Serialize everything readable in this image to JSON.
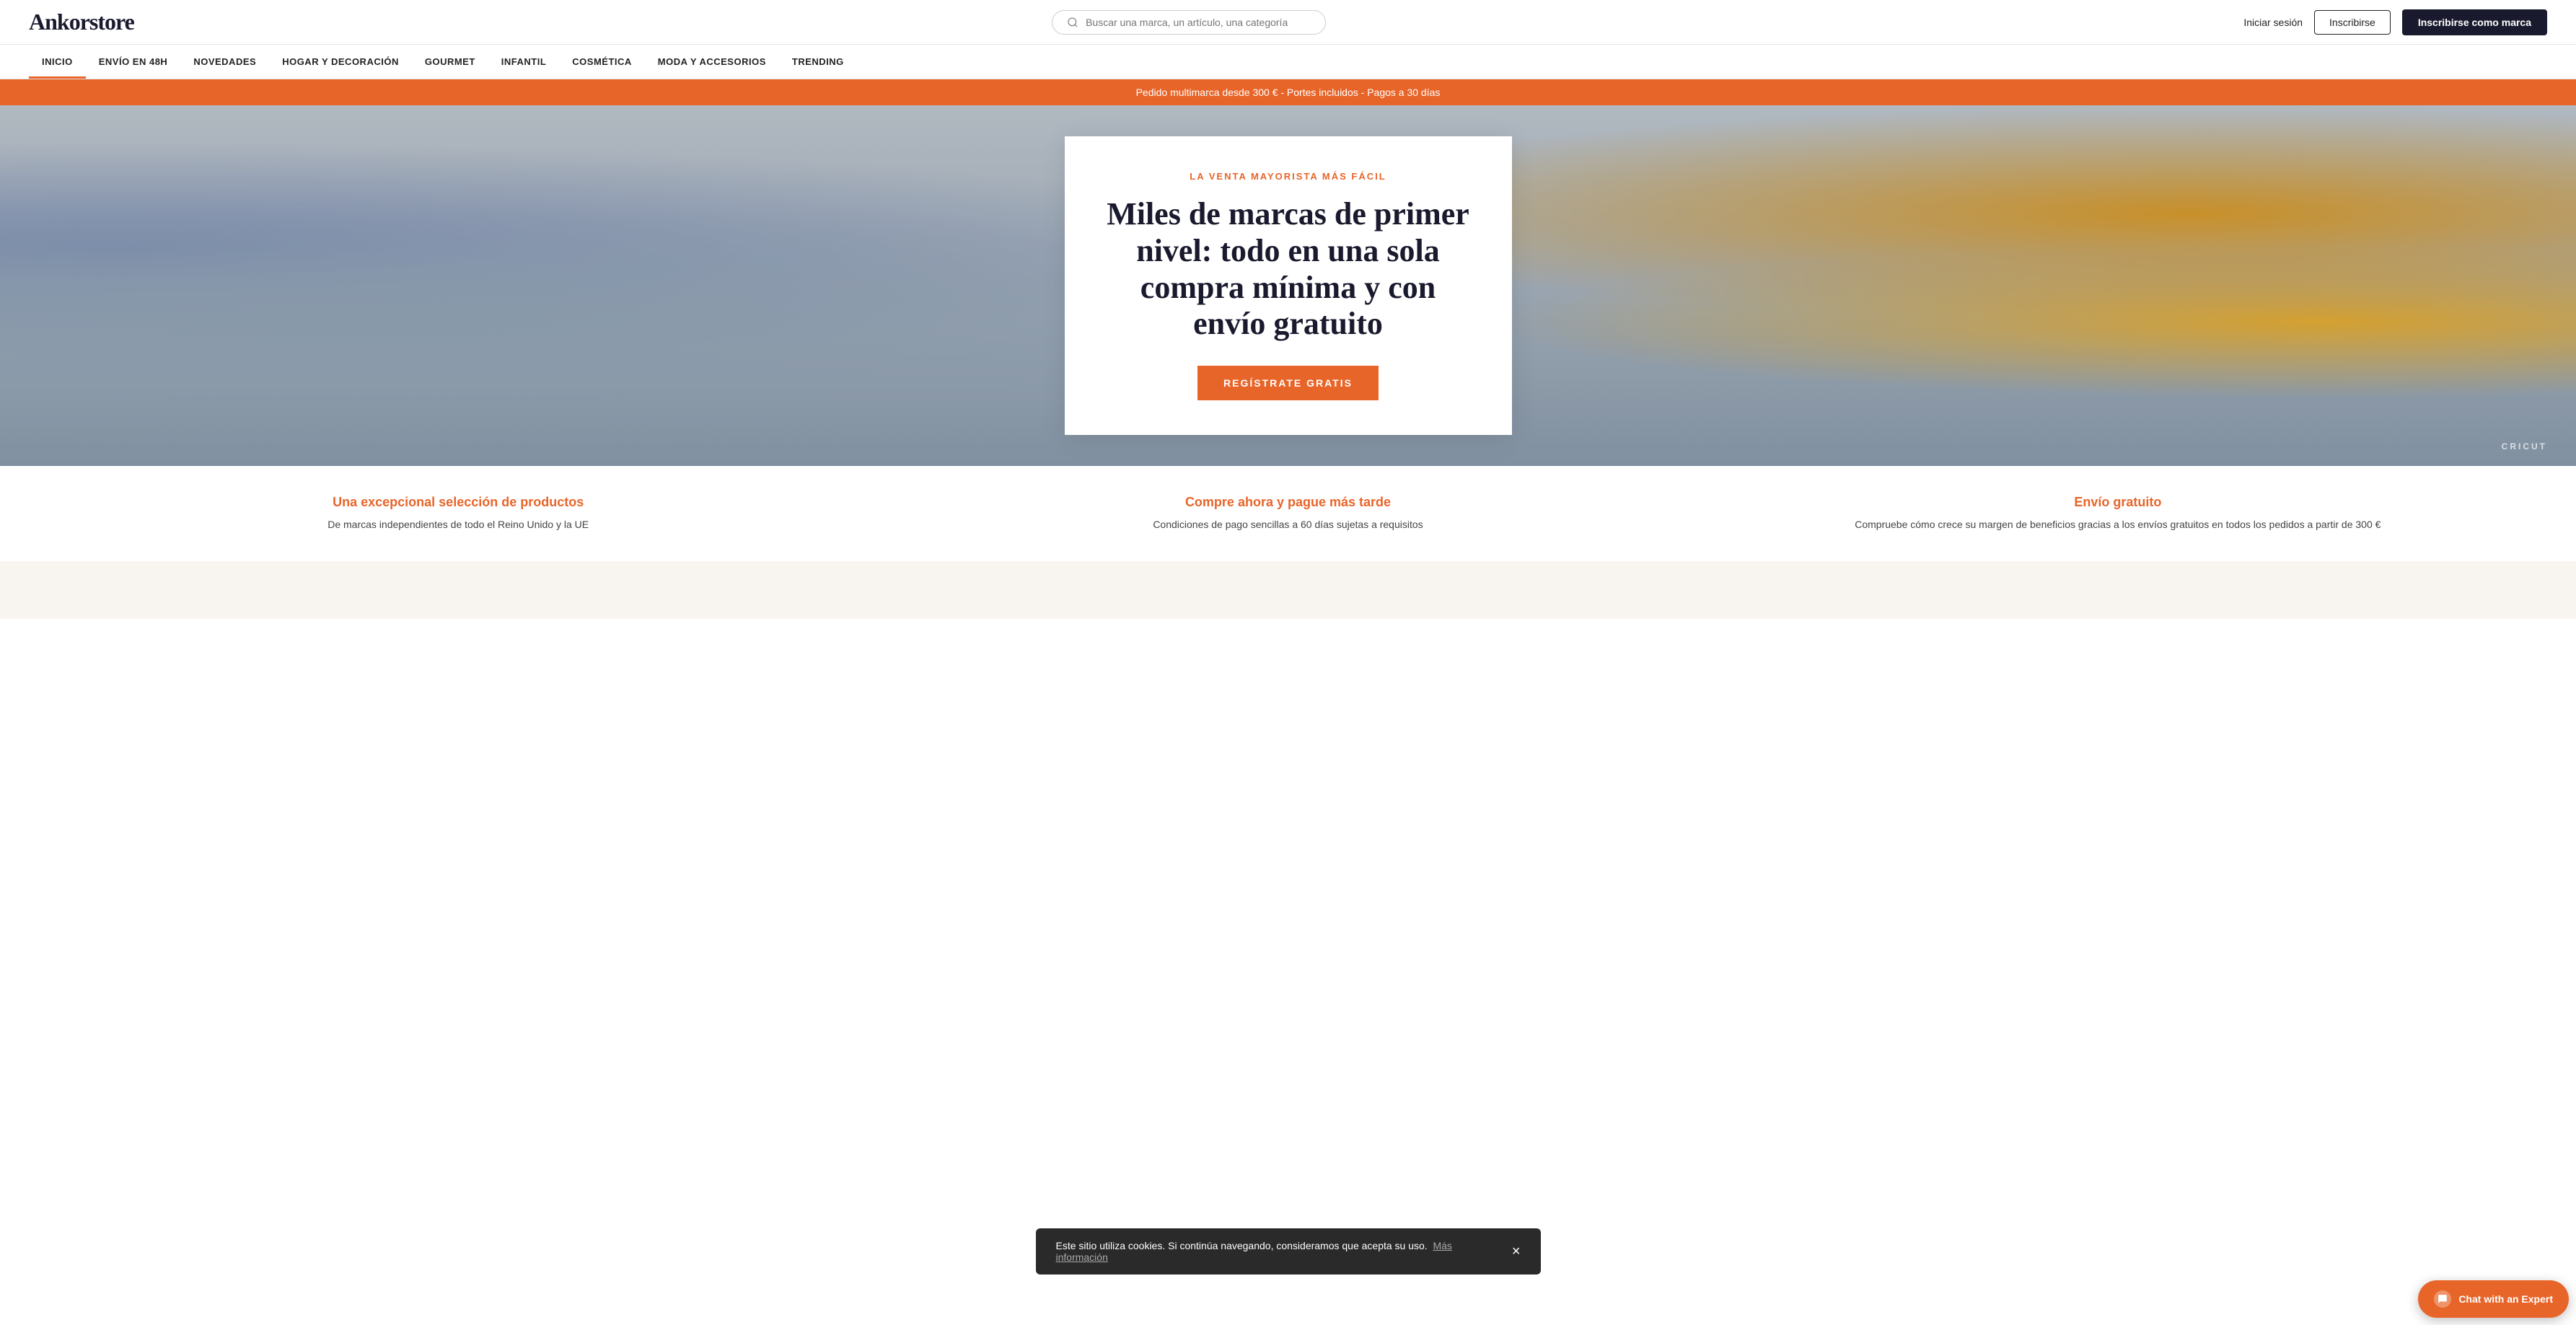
{
  "header": {
    "logo": "Ankorstore",
    "search_placeholder": "Buscar una marca, un artículo, una categoría",
    "login_label": "Iniciar sesión",
    "register_label": "Inscribirse",
    "brand_register_label": "Inscribirse como marca"
  },
  "nav": {
    "items": [
      {
        "label": "INICIO",
        "active": true
      },
      {
        "label": "ENVÍO EN 48H",
        "active": false
      },
      {
        "label": "NOVEDADES",
        "active": false
      },
      {
        "label": "HOGAR Y DECORACIÓN",
        "active": false
      },
      {
        "label": "GOURMET",
        "active": false
      },
      {
        "label": "INFANTIL",
        "active": false
      },
      {
        "label": "COSMÉTICA",
        "active": false
      },
      {
        "label": "MODA Y ACCESORIOS",
        "active": false
      },
      {
        "label": "TRENDING",
        "active": false
      }
    ]
  },
  "promo_banner": {
    "text": "Pedido multimarca desde 300 € - Portes incluidos - Pagos a 30 días"
  },
  "hero": {
    "subtitle": "LA VENTA MAYORISTA MÁS FÁCIL",
    "title": "Miles de marcas de primer nivel: todo en una sola compra mínima y con envío gratuito",
    "cta_label": "REGÍSTRATE GRATIS",
    "brand_label": "CRICUT"
  },
  "features": [
    {
      "title": "Una excepcional selección de productos",
      "desc": "De marcas independientes de todo el Reino Unido y la UE"
    },
    {
      "title": "Compre ahora y pague más tarde",
      "desc": "Condiciones de pago sencillas a 60 días sujetas a requisitos"
    },
    {
      "title": "Envío gratuito",
      "desc": "Compruebe cómo crece su margen de beneficios gracias a los envíos gratuitos en todos los pedidos a partir de 300 €"
    }
  ],
  "cookie_banner": {
    "text": "Este sitio utiliza cookies. Si continúa navegando, consideramos que acepta su uso.",
    "link_text": "Más información",
    "close_icon": "×"
  },
  "chat": {
    "label": "Chat with an Expert",
    "icon": "💬"
  }
}
